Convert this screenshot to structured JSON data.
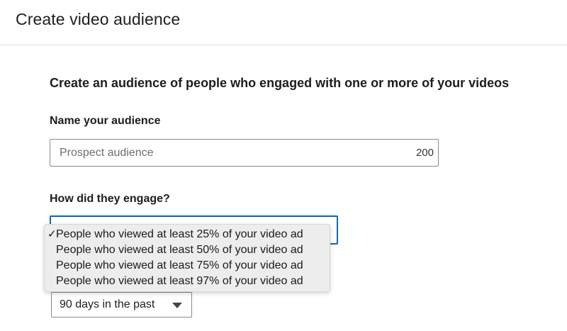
{
  "header": {
    "title": "Create video audience"
  },
  "form": {
    "intro": "Create an audience of people who engaged with one or more of your videos",
    "name_label": "Name your audience",
    "name_input": {
      "value": "",
      "placeholder": "Prospect audience",
      "char_count": "200"
    },
    "engage_label": "How did they engage?",
    "engage_options": [
      {
        "check": "✓",
        "label": "People who viewed at least 25% of your video ad"
      },
      {
        "check": "",
        "label": "People who viewed at least 50% of your video ad"
      },
      {
        "check": "",
        "label": "People who viewed at least 75% of your video ad"
      },
      {
        "check": "",
        "label": "People who viewed at least 97% of your video ad"
      }
    ],
    "time_range": {
      "selected": "90 days in the past"
    }
  },
  "icons": {
    "checkmark": "check-icon",
    "dropdown_caret": "caret-down-icon"
  },
  "colors": {
    "focus_border": "#0a66c2",
    "menu_bg": "#ededed"
  }
}
